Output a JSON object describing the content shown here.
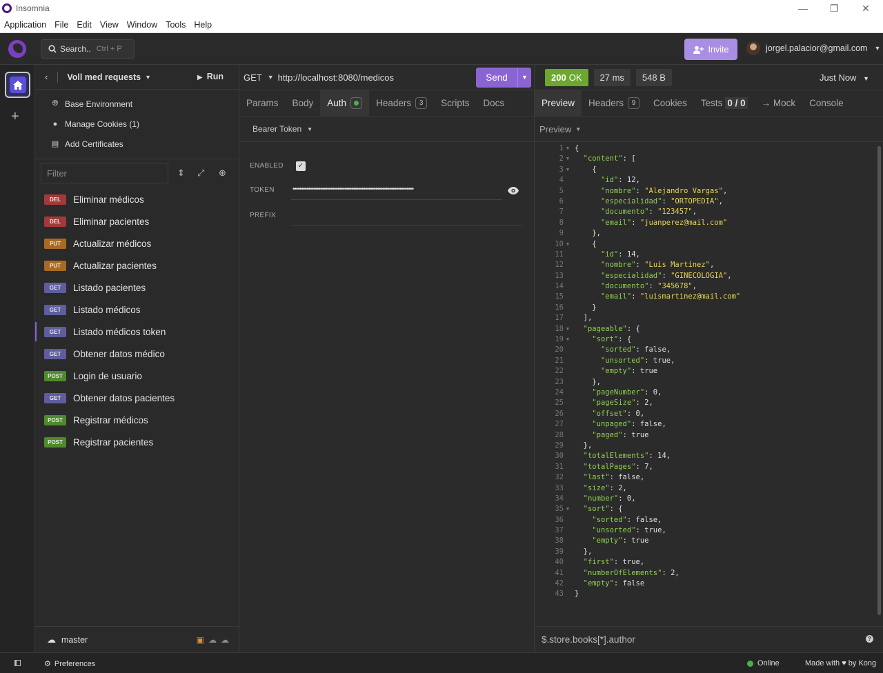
{
  "window": {
    "title": "Insomnia",
    "minimize": "—",
    "maximize": "❐",
    "close": "✕"
  },
  "menu": [
    "Application",
    "File",
    "Edit",
    "View",
    "Window",
    "Tools",
    "Help"
  ],
  "header": {
    "search_label": "Search..",
    "search_shortcut": "Ctrl + P",
    "invite_label": "Invite",
    "user_email": "jorgel.palacior@gmail.com"
  },
  "sidebar": {
    "project_name": "Voll med requests",
    "run_label": "Run",
    "links": [
      {
        "icon": "globe-icon",
        "label": "Base Environment"
      },
      {
        "icon": "cookie-icon",
        "label": "Manage Cookies (1)"
      },
      {
        "icon": "certificate-icon",
        "label": "Add Certificates"
      }
    ],
    "filter_placeholder": "Filter",
    "requests": [
      {
        "method": "DEL",
        "name": "Eliminar médicos"
      },
      {
        "method": "DEL",
        "name": "Eliminar pacientes"
      },
      {
        "method": "PUT",
        "name": "Actualizar médicos"
      },
      {
        "method": "PUT",
        "name": "Actualizar pacientes"
      },
      {
        "method": "GET",
        "name": "Listado pacientes"
      },
      {
        "method": "GET",
        "name": "Listado médicos"
      },
      {
        "method": "GET",
        "name": "Listado médicos token"
      },
      {
        "method": "GET",
        "name": "Obtener datos médico"
      },
      {
        "method": "POST",
        "name": "Login de usuario"
      },
      {
        "method": "GET",
        "name": "Obtener datos pacientes"
      },
      {
        "method": "POST",
        "name": "Registrar médicos"
      },
      {
        "method": "POST",
        "name": "Registrar pacientes"
      }
    ],
    "active_request": "Listado médicos token",
    "branch": "master"
  },
  "request": {
    "method": "GET",
    "url": "http://localhost:8080/medicos",
    "send_label": "Send",
    "tabs": [
      {
        "label": "Params",
        "badge": ""
      },
      {
        "label": "Body",
        "badge": ""
      },
      {
        "label": "Auth",
        "badge": ""
      },
      {
        "label": "Headers",
        "badge": "3"
      },
      {
        "label": "Scripts",
        "badge": ""
      },
      {
        "label": "Docs",
        "badge": ""
      }
    ],
    "active_tab": "Auth",
    "auth_type": "Bearer Token",
    "enabled_label": "ENABLED",
    "enabled_checked": true,
    "token_label": "TOKEN",
    "token_mask": "••••••••••••••••••••••••••••••••••••••••••••••••••••••••••••••••••••••",
    "prefix_label": "PREFIX"
  },
  "response": {
    "status_code": "200",
    "status_text": "OK",
    "time": "27 ms",
    "size": "548 B",
    "timestamp": "Just Now",
    "tabs": [
      {
        "label": "Preview",
        "badge": ""
      },
      {
        "label": "Headers",
        "badge": "9"
      },
      {
        "label": "Cookies",
        "badge": ""
      },
      {
        "label": "Tests",
        "badge": "0 / 0"
      },
      {
        "label": "→ Mock",
        "badge": ""
      },
      {
        "label": "Console",
        "badge": ""
      }
    ],
    "active_tab": "Preview",
    "preview_mode": "Preview",
    "body_lines": [
      "{",
      "  \"content\": [",
      "    {",
      "      \"id\": 12,",
      "      \"nombre\": \"Alejandro Vargas\",",
      "      \"especialidad\": \"ORTOPEDIA\",",
      "      \"documento\": \"123457\",",
      "      \"email\": \"juanperez@mail.com\"",
      "    },",
      "    {",
      "      \"id\": 14,",
      "      \"nombre\": \"Luis Martínez\",",
      "      \"especialidad\": \"GINECOLOGIA\",",
      "      \"documento\": \"345678\",",
      "      \"email\": \"luismartinez@mail.com\"",
      "    }",
      "  ],",
      "  \"pageable\": {",
      "    \"sort\": {",
      "      \"sorted\": false,",
      "      \"unsorted\": true,",
      "      \"empty\": true",
      "    },",
      "    \"pageNumber\": 0,",
      "    \"pageSize\": 2,",
      "    \"offset\": 0,",
      "    \"unpaged\": false,",
      "    \"paged\": true",
      "  },",
      "  \"totalElements\": 14,",
      "  \"totalPages\": 7,",
      "  \"last\": false,",
      "  \"size\": 2,",
      "  \"number\": 0,",
      "  \"sort\": {",
      "    \"sorted\": false,",
      "    \"unsorted\": true,",
      "    \"empty\": true",
      "  },",
      "  \"first\": true,",
      "  \"numberOfElements\": 2,",
      "  \"empty\": false",
      "}"
    ],
    "foldable_lines": [
      1,
      2,
      3,
      10,
      18,
      19,
      35
    ],
    "filter_value": "$.store.books[*].author"
  },
  "footer": {
    "preferences_label": "Preferences",
    "online_label": "Online",
    "made_with_label": "Made with",
    "by_label": "by Kong"
  },
  "colors": {
    "accent": "#8b64d4",
    "status_ok": "#6da730",
    "json_key": "#8fd14f",
    "json_string": "#e6d454"
  }
}
